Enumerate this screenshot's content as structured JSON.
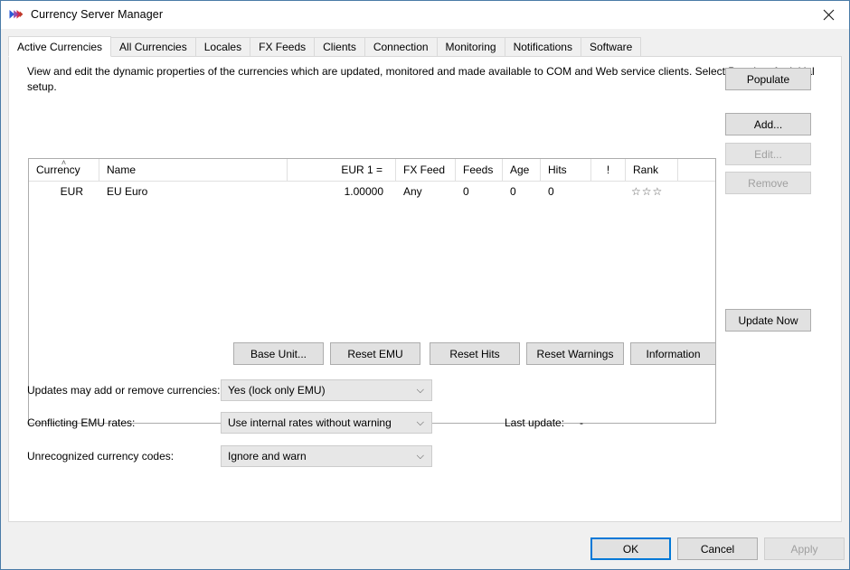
{
  "window": {
    "title": "Currency Server Manager",
    "app_icon": "currency-x-icon",
    "close_label": "✕"
  },
  "tabs": [
    {
      "label": "Active Currencies",
      "active": true
    },
    {
      "label": "All Currencies",
      "active": false
    },
    {
      "label": "Locales",
      "active": false
    },
    {
      "label": "FX Feeds",
      "active": false
    },
    {
      "label": "Clients",
      "active": false
    },
    {
      "label": "Connection",
      "active": false
    },
    {
      "label": "Monitoring",
      "active": false
    },
    {
      "label": "Notifications",
      "active": false
    },
    {
      "label": "Software",
      "active": false
    }
  ],
  "main": {
    "description": "View and edit the dynamic properties of the currencies which are updated, monitored and made available to COM and Web service clients. Select Populate for initial setup.",
    "table": {
      "sort_indicator": "˄",
      "columns": [
        {
          "key": "currency",
          "label": "Currency",
          "sorted": true
        },
        {
          "key": "name",
          "label": "Name"
        },
        {
          "key": "rate",
          "label": "EUR 1 ="
        },
        {
          "key": "fxfeed",
          "label": "FX Feed"
        },
        {
          "key": "feeds",
          "label": "Feeds"
        },
        {
          "key": "age",
          "label": "Age"
        },
        {
          "key": "hits",
          "label": "Hits"
        },
        {
          "key": "warn",
          "label": "!"
        },
        {
          "key": "rank",
          "label": "Rank"
        },
        {
          "key": "pad",
          "label": ""
        }
      ],
      "rows": [
        {
          "currency": "EUR",
          "name": "EU Euro",
          "rate": "1.00000",
          "fxfeed": "Any",
          "feeds": "0",
          "age": "0",
          "hits": "0",
          "warn": "",
          "rank": "☆☆☆",
          "pad": ""
        }
      ]
    },
    "side_buttons": [
      {
        "label": "Populate",
        "enabled": true
      },
      {
        "label": "Add...",
        "enabled": true
      },
      {
        "label": "Edit...",
        "enabled": false
      },
      {
        "label": "Remove",
        "enabled": false
      }
    ],
    "update_now": {
      "label": "Update Now",
      "enabled": true
    },
    "lower_buttons": [
      {
        "label": "Base Unit...",
        "enabled": true
      },
      {
        "label": "Reset EMU",
        "enabled": true
      },
      {
        "label": "Reset Hits",
        "enabled": true
      },
      {
        "label": "Reset Warnings",
        "enabled": true
      },
      {
        "label": "Information",
        "enabled": true
      }
    ],
    "options": [
      {
        "label": "Updates may add or remove currencies:",
        "value": "Yes (lock only EMU)",
        "arrow": "⌵"
      },
      {
        "label": "Conflicting EMU rates:",
        "value": "Use internal rates without warning",
        "arrow": "⌵"
      },
      {
        "label": "Unrecognized currency codes:",
        "value": "Ignore and warn",
        "arrow": "⌵"
      }
    ],
    "last_update": {
      "label": "Last update:",
      "value": "-"
    }
  },
  "footer": {
    "ok_label": "OK",
    "cancel_label": "Cancel",
    "apply_label": "Apply"
  }
}
